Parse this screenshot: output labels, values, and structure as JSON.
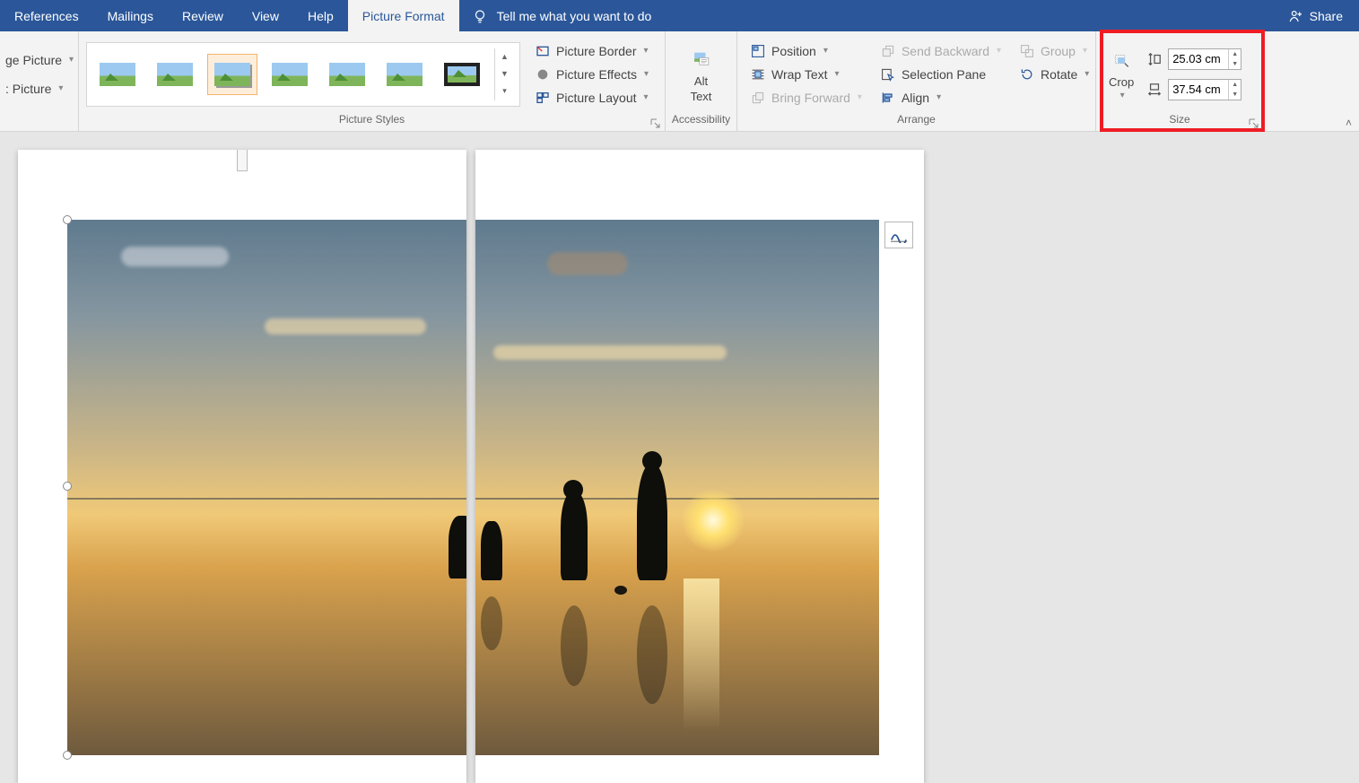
{
  "tabs": {
    "references": "References",
    "mailings": "Mailings",
    "review": "Review",
    "view": "View",
    "help": "Help",
    "picture_format": "Picture Format"
  },
  "tellme": {
    "placeholder": "Tell me what you want to do"
  },
  "share": "Share",
  "left_clipped": {
    "change_picture": "ge Picture",
    "reset_picture": ": Picture"
  },
  "groups": {
    "picture_styles": "Picture Styles",
    "accessibility": "Accessibility",
    "arrange": "Arrange",
    "size": "Size"
  },
  "picture_tools": {
    "border": "Picture Border",
    "effects": "Picture Effects",
    "layout": "Picture Layout"
  },
  "alt_text": {
    "line1": "Alt",
    "line2": "Text"
  },
  "arrange": {
    "position": "Position",
    "wrap_text": "Wrap Text",
    "bring_forward": "Bring Forward",
    "send_backward": "Send Backward",
    "selection_pane": "Selection Pane",
    "align": "Align",
    "group": "Group",
    "rotate": "Rotate"
  },
  "size": {
    "crop": "Crop",
    "height": "25.03 cm",
    "width": "37.54 cm"
  }
}
